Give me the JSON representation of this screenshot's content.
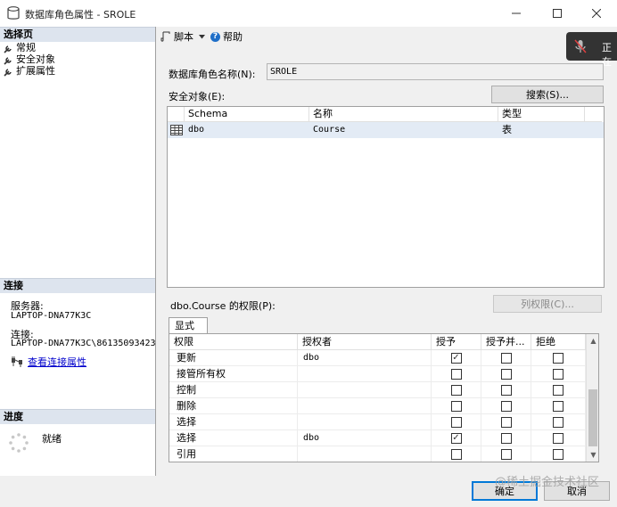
{
  "window": {
    "title": "数据库角色属性 - SROLE"
  },
  "left_pane": {
    "select_page_header": "选择页",
    "nav_items": [
      {
        "label": "常规"
      },
      {
        "label": "安全对象"
      },
      {
        "label": "扩展属性"
      }
    ],
    "connection_header": "连接",
    "server_label": "服务器:",
    "server_value": "LAPTOP-DNA77K3C",
    "connection_label": "连接:",
    "connection_value": "LAPTOP-DNA77K3C\\86135093423",
    "view_connection_link": "查看连接属性",
    "progress_header": "进度",
    "progress_status": "就绪"
  },
  "toolbar": {
    "script_label": "脚本",
    "help_label": "帮助"
  },
  "overlay": {
    "text": "正在"
  },
  "main": {
    "role_name_label": "数据库角色名称(N):",
    "role_name_value": "SROLE",
    "securables_label": "安全对象(E):",
    "search_button": "搜索(S)...",
    "securables_columns": [
      "Schema",
      "名称",
      "类型"
    ],
    "securables_rows": [
      {
        "schema": "dbo",
        "name": "Course",
        "type": "表"
      }
    ],
    "permissions_label": "dbo.Course 的权限(P):",
    "column_permissions_button": "列权限(C)...",
    "tab_explicit": "显式",
    "permission_columns": [
      "权限",
      "授权者",
      "授予",
      "授予并...",
      "拒绝"
    ],
    "permission_rows": [
      {
        "permission": "更新",
        "grantor": "dbo",
        "grant": true,
        "with_grant": false,
        "deny": false
      },
      {
        "permission": "接管所有权",
        "grantor": "",
        "grant": false,
        "with_grant": false,
        "deny": false
      },
      {
        "permission": "控制",
        "grantor": "",
        "grant": false,
        "with_grant": false,
        "deny": false
      },
      {
        "permission": "删除",
        "grantor": "",
        "grant": false,
        "with_grant": false,
        "deny": false
      },
      {
        "permission": "选择",
        "grantor": "",
        "grant": false,
        "with_grant": false,
        "deny": false
      },
      {
        "permission": "选择",
        "grantor": "dbo",
        "grant": true,
        "with_grant": false,
        "deny": false
      },
      {
        "permission": "引用",
        "grantor": "",
        "grant": false,
        "with_grant": false,
        "deny": false
      }
    ]
  },
  "footer": {
    "ok_button": "确定",
    "cancel_button": "取消"
  },
  "watermark": "@稀土掘金技术社区"
}
